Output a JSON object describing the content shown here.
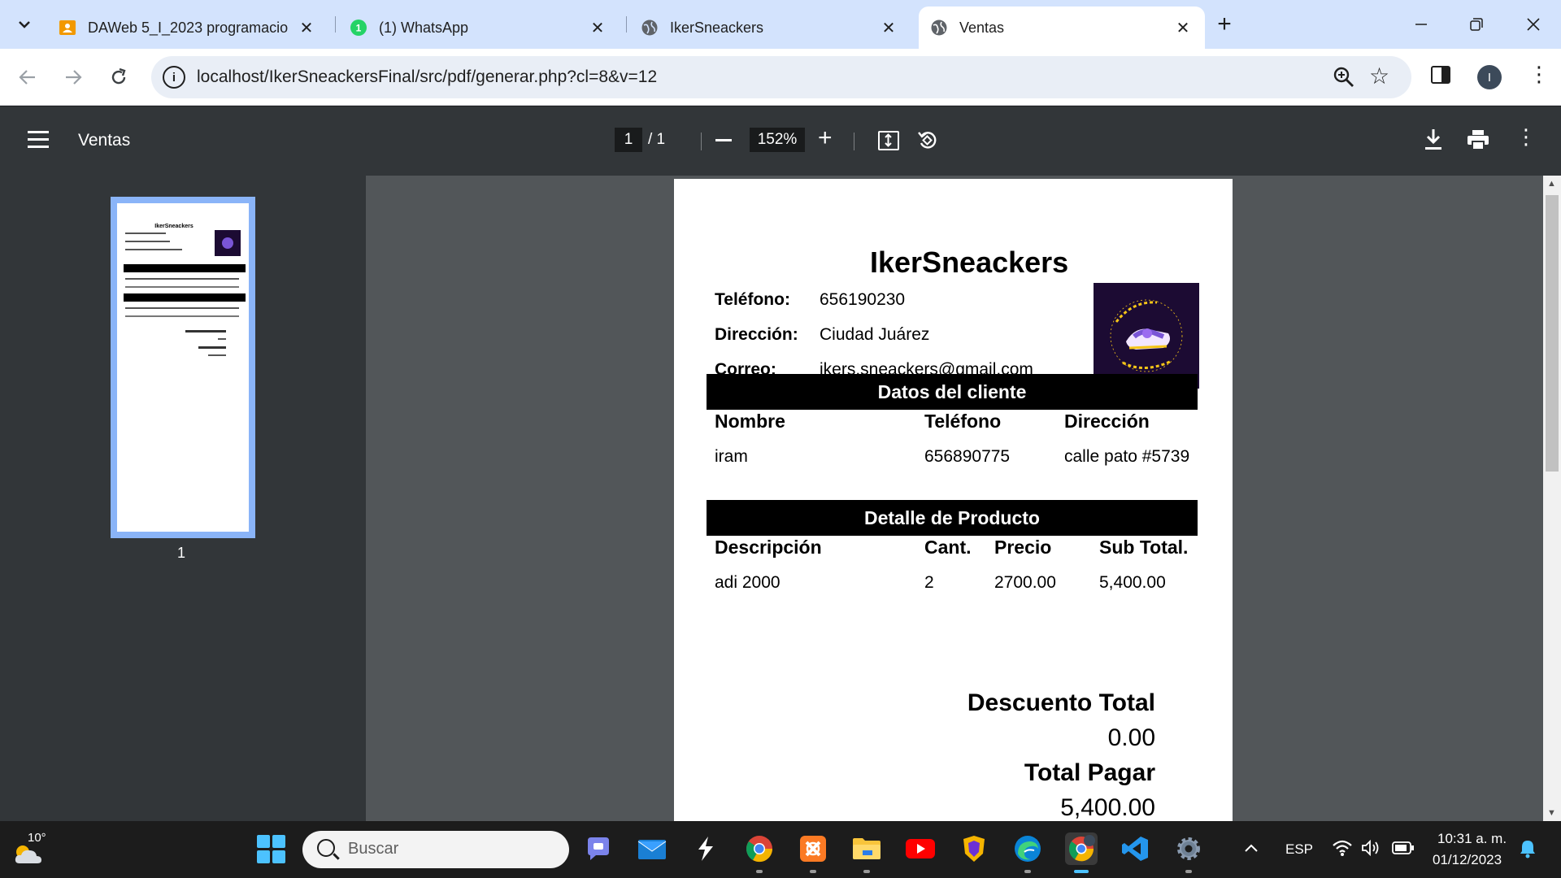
{
  "browser": {
    "tabs": [
      {
        "title": "DAWeb 5_I_2023 programacio"
      },
      {
        "title": "(1) WhatsApp",
        "badge": "1"
      },
      {
        "title": "IkerSneackers"
      },
      {
        "title": "Ventas"
      }
    ],
    "url": "localhost/IkerSneackersFinal/src/pdf/generar.php?cl=8&v=12",
    "profile_initial": "I"
  },
  "pdf_viewer": {
    "title": "Ventas",
    "current_page": "1",
    "page_total": "/ 1",
    "zoom": "152%",
    "thumbnail_label": "1"
  },
  "document": {
    "store_name": "IkerSneackers",
    "contact": [
      {
        "label": "Teléfono:",
        "value": "656190230"
      },
      {
        "label": "Dirección:",
        "value": "Ciudad Juárez"
      },
      {
        "label": "Correo:",
        "value": "ikers.sneackers@gmail.com"
      }
    ],
    "client_section_title": "Datos del cliente",
    "client_headers": [
      "Nombre",
      "Teléfono",
      "Dirección"
    ],
    "client_row": [
      "iram",
      "656890775",
      "calle pato #5739"
    ],
    "product_section_title": "Detalle de Producto",
    "product_headers": [
      "Descripción",
      "Cant.",
      "Precio",
      "Sub Total."
    ],
    "product_row": [
      "adi 2000",
      "2",
      "2700.00",
      "5,400.00"
    ],
    "discount_label": "Descuento Total",
    "discount_value": "0.00",
    "total_label": "Total Pagar",
    "total_value": "5,400.00"
  },
  "taskbar": {
    "weather_temp": "10°",
    "search_placeholder": "Buscar",
    "language": "ESP",
    "time": "10:31 a. m.",
    "date": "01/12/2023"
  },
  "colors": {
    "tabstrip": "#d3e3fd",
    "pdf_toolbar": "#323639",
    "pdf_background": "#525659",
    "logo_background": "#1c0b33",
    "accent_blue": "#8ab4f8"
  }
}
